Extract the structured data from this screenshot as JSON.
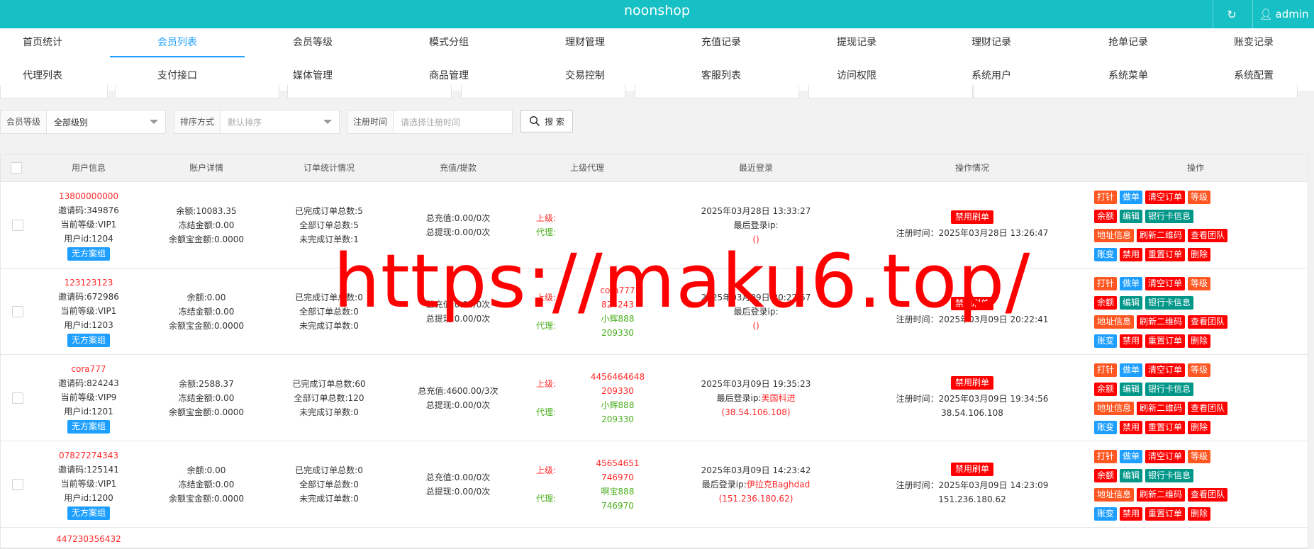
{
  "header": {
    "brand": "noonshop",
    "user": "admin"
  },
  "nav": [
    [
      "首页统计",
      "会员列表",
      "会员等级",
      "模式分组",
      "理财管理",
      "充值记录",
      "提现记录",
      "理财记录",
      "抢单记录",
      "账变记录"
    ],
    [
      "代理列表",
      "支付接口",
      "媒体管理",
      "商品管理",
      "交易控制",
      "客服列表",
      "访问权限",
      "系统用户",
      "系统菜单",
      "系统配置"
    ]
  ],
  "filters": {
    "level_label": "会员等级",
    "level_value": "全部级别",
    "sort_label": "排序方式",
    "sort_placeholder": "默认排序",
    "regtime_label": "注册时间",
    "regtime_placeholder": "请选择注册时间",
    "search_label": "搜 索"
  },
  "table": {
    "headers": [
      "用户信息",
      "账户详情",
      "订单统计情况",
      "充值/提款",
      "上级代理",
      "最近登录",
      "操作情况",
      "操作"
    ],
    "rows": [
      {
        "phone": "13800000000",
        "invite": "邀请码:349876",
        "level": "当前等级:VIP1",
        "uid": "用户id:1204",
        "group": "无方案组",
        "balance": "余额:10083.35",
        "frozen": "冻结金额:0.00",
        "yeb": "余额宝金额:0.0000",
        "done": "已完成订单总数:5",
        "all": "全部订单总数:5",
        "undone": "未完成订单数:1",
        "recharge": "总充值:0.00/0次",
        "withdraw": "总提现:0.00/0次",
        "sup_label": "上级:",
        "sup_val1": "",
        "sup_val2": "",
        "agent_label": "代理:",
        "agent_val1": "",
        "agent_val2": "",
        "login_time": "2025年03月28日 13:33:27",
        "login_ip_label": "最后登录ip:",
        "login_ip_loc": "",
        "login_ip": "()",
        "status": "禁用刷单",
        "reg_time": "注册时间：2025年03月28日 13:26:47",
        "reg_ip": ""
      },
      {
        "phone": "123123123",
        "invite": "邀请码:672986",
        "level": "当前等级:VIP1",
        "uid": "用户id:1203",
        "group": "无方案组",
        "balance": "余额:0.00",
        "frozen": "冻结金额:0.00",
        "yeb": "余额宝金额:0.0000",
        "done": "已完成订单总数:0",
        "all": "全部订单总数:0",
        "undone": "未完成订单数:0",
        "recharge": "总充值:0.00/0次",
        "withdraw": "总提现:0.00/0次",
        "sup_label": "上级:",
        "sup_val1": "cora777",
        "sup_val2": "824243",
        "agent_label": "代理:",
        "agent_val1": "小辉888",
        "agent_val2": "209330",
        "login_time": "2025年03月09日 20:22:57",
        "login_ip_label": "最后登录ip:",
        "login_ip_loc": "",
        "login_ip": "()",
        "status": "禁用刷单",
        "reg_time": "注册时间：2025年03月09日 20:22:41",
        "reg_ip": ""
      },
      {
        "phone": "cora777",
        "invite": "邀请码:824243",
        "level": "当前等级:VIP9",
        "uid": "用户id:1201",
        "group": "无方案组",
        "balance": "余额:2588.37",
        "frozen": "冻结金额:0.00",
        "yeb": "余额宝金额:0.0000",
        "done": "已完成订单总数:60",
        "all": "全部订单总数:120",
        "undone": "未完成订单数:0",
        "recharge": "总充值:4600.00/3次",
        "withdraw": "总提现:0.00/0次",
        "sup_label": "上级:",
        "sup_val1": "4456464648",
        "sup_val2": "209330",
        "agent_label": "代理:",
        "agent_val1": "小辉888",
        "agent_val2": "209330",
        "login_time": "2025年03月09日 19:35:23",
        "login_ip_label": "最后登录ip:",
        "login_ip_loc": "美国科进",
        "login_ip": "(38.54.106.108)",
        "status": "禁用刷单",
        "reg_time": "注册时间：2025年03月09日 19:34:56",
        "reg_ip": "38.54.106.108"
      },
      {
        "phone": "07827274343",
        "invite": "邀请码:125141",
        "level": "当前等级:VIP1",
        "uid": "用户id:1200",
        "group": "无方案组",
        "balance": "余额:0.00",
        "frozen": "冻结金额:0.00",
        "yeb": "余额宝金额:0.0000",
        "done": "已完成订单总数:0",
        "all": "全部订单总数:0",
        "undone": "未完成订单数:0",
        "recharge": "总充值:0.00/0次",
        "withdraw": "总提现:0.00/0次",
        "sup_label": "上级:",
        "sup_val1": "45654651",
        "sup_val2": "746970",
        "agent_label": "代理:",
        "agent_val1": "啊宝888",
        "agent_val2": "746970",
        "login_time": "2025年03月09日 14:23:42",
        "login_ip_label": "最后登录ip:",
        "login_ip_loc": "伊拉克Baghdad",
        "login_ip": "(151.236.180.62)",
        "status": "禁用刷单",
        "reg_time": "注册时间：2025年03月09日 14:23:09",
        "reg_ip": "151.236.180.62"
      }
    ],
    "partial_row_phone": "447230356432",
    "ops": [
      "打针",
      "做单",
      "清空订单",
      "等级",
      "余额",
      "编辑",
      "银行卡信息",
      "地址信息",
      "刷新二维码",
      "查看团队",
      "账变",
      "禁用",
      "重置订单",
      "删除"
    ]
  },
  "watermark": "https://maku6.top/",
  "colors": {
    "topbar": "#16c0c5",
    "accent": "#1e9fff",
    "danger": "#ff0000",
    "orange": "#ff5722",
    "teal": "#009688"
  }
}
